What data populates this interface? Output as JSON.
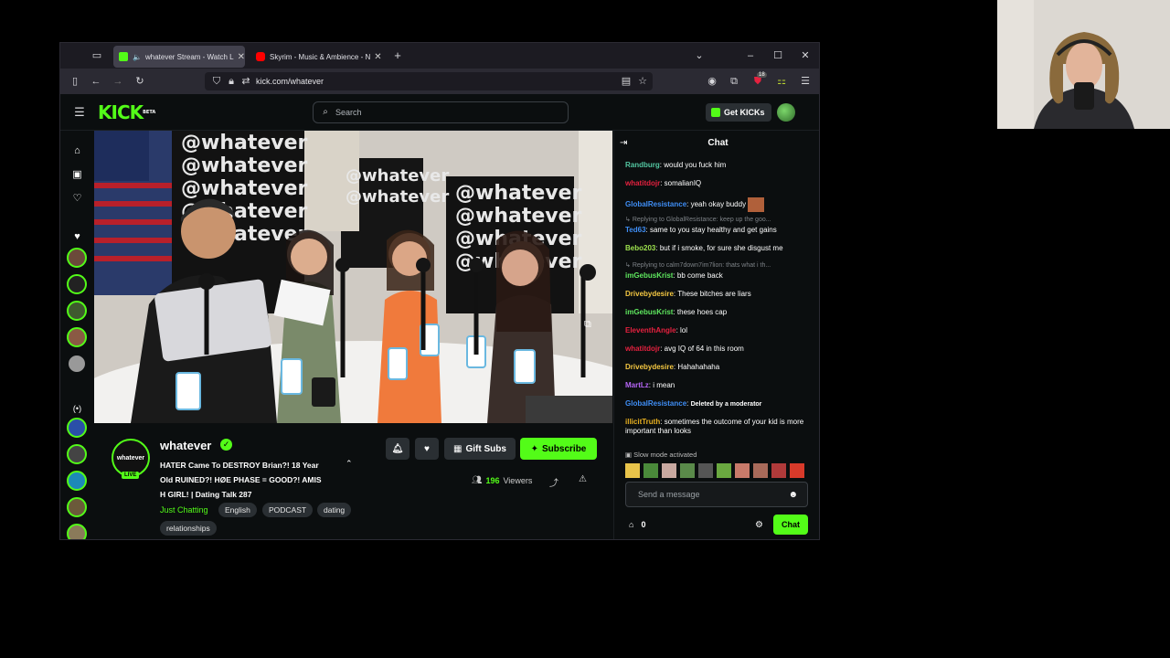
{
  "browser": {
    "tabs": [
      {
        "label": "whatever Stream - Watch L"
      },
      {
        "label": "Skyrim - Music & Ambience - N"
      }
    ],
    "url": "kick.com/whatever",
    "badge_count": "18"
  },
  "header": {
    "logo_text": "KICK",
    "logo_beta": "BETA",
    "search_placeholder": "Search",
    "get_kicks_label": "Get KICKs"
  },
  "channel": {
    "name": "whatever",
    "live_badge": "LIVE",
    "avatar_text": "whatever",
    "title_lines": [
      "HATER Came To DESTROY Brian?! 18 Year",
      "Old RUINED?! HØE PHASE = GOOD?! AMIS",
      "H GIRL! | Dating Talk 287"
    ],
    "category": "Just Chatting",
    "tags": [
      "English",
      "PODCAST",
      "dating",
      "relationships"
    ],
    "gift_subs_label": "Gift Subs",
    "subscribe_label": "Subscribe",
    "viewers_count": "196",
    "viewers_label": "Viewers"
  },
  "chat": {
    "title": "Chat",
    "messages": [
      {
        "user": "Randburg",
        "color": "#53c6a1",
        "text": "would you fuck him"
      },
      {
        "user": "whatitdojr",
        "color": "#e5213f",
        "text": "somalianIQ"
      },
      {
        "user": "GlobalResistance",
        "color": "#3f8ef5",
        "text": "yeah okay buddy"
      },
      {
        "reply": "Replying to GlobalResistance: keep up the goo...",
        "user": "Ted63",
        "color": "#3f8ef5",
        "text": "same to you stay healthy and get gains"
      },
      {
        "user": "Bebo203",
        "color": "#9ee34e",
        "text": "but if i smoke, for sure she disgust me"
      },
      {
        "reply": "Replying to calm7down7im7lion: thats what i th...",
        "user": "imGebusKrist",
        "color": "#5fe85f",
        "text": "bb come back"
      },
      {
        "user": "Drivebydesire",
        "color": "#f5c842",
        "text": "These bitches are liars"
      },
      {
        "user": "imGebusKrist",
        "color": "#5fe85f",
        "text": "these hoes cap"
      },
      {
        "user": "EleventhAngle",
        "color": "#e5213f",
        "text": "lol"
      },
      {
        "user": "whatitdojr",
        "color": "#e5213f",
        "text": "avg IQ of 64 in this room"
      },
      {
        "user": "Drivebydesire",
        "color": "#f5c842",
        "text": "Hahahahaha"
      },
      {
        "user": "MartLz",
        "color": "#b565f5",
        "text": "i mean"
      },
      {
        "user": "GlobalResistance",
        "color": "#3f8ef5",
        "text": "Deleted by a moderator"
      },
      {
        "user": "illicitTruth",
        "color": "#e8b020",
        "text": "sometimes the outcome of your kid is more important than looks"
      }
    ],
    "slow_mode": "Slow mode activated",
    "input_placeholder": "Send a message",
    "points": "0",
    "send_label": "Chat"
  },
  "colors": {
    "accent": "#53fc18",
    "bg": "#0b0e0f"
  }
}
